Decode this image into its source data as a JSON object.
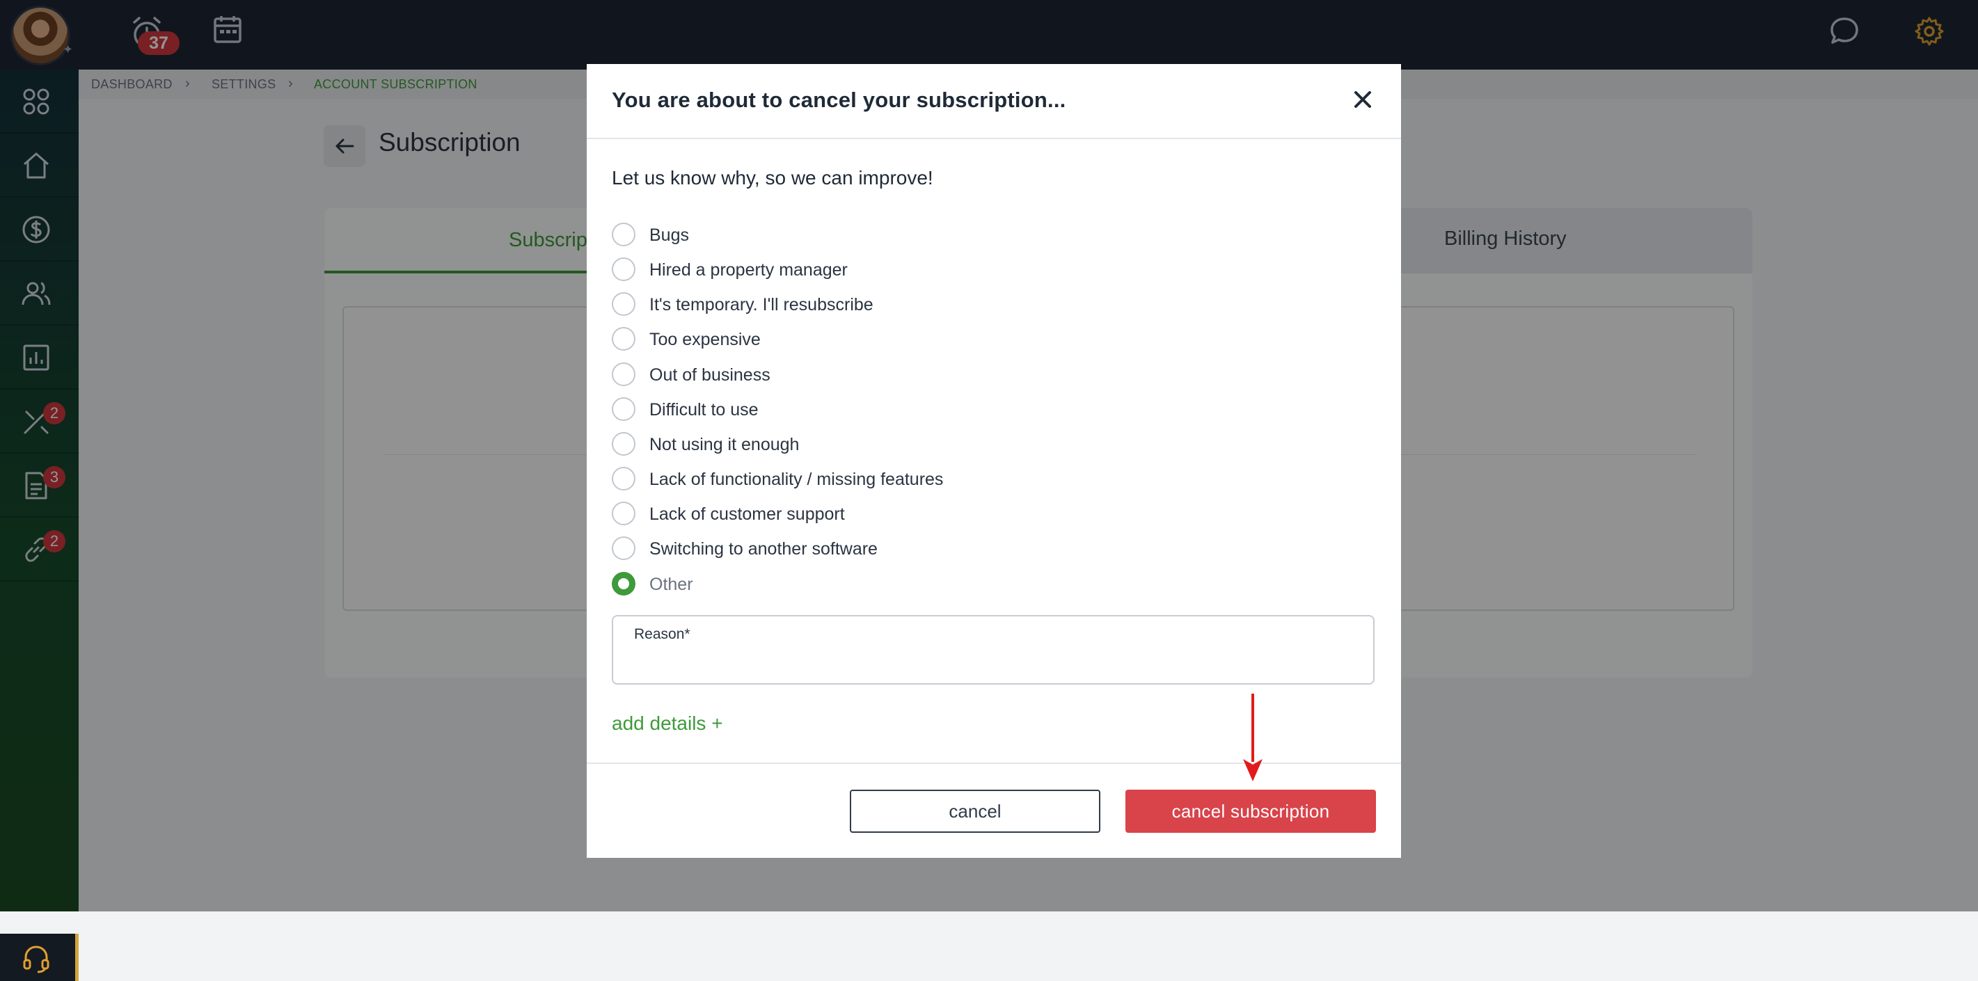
{
  "topbar": {
    "alarm_badge": "37",
    "icons": [
      "avatar",
      "pin-icon",
      "alarm-clock-icon",
      "calendar-icon",
      "chat-icon",
      "gear-icon"
    ],
    "accent_color": "#e0a030"
  },
  "sidebar": {
    "items": [
      {
        "icon": "apps-grid-icon",
        "badge": ""
      },
      {
        "icon": "home-icon",
        "badge": ""
      },
      {
        "icon": "dollar-icon",
        "badge": ""
      },
      {
        "icon": "users-icon",
        "badge": ""
      },
      {
        "icon": "reports-icon",
        "badge": ""
      },
      {
        "icon": "tools-icon",
        "badge": "2"
      },
      {
        "icon": "document-icon",
        "badge": "3"
      },
      {
        "icon": "link-icon",
        "badge": "2"
      }
    ],
    "support_icon": "headset-icon"
  },
  "breadcrumb": [
    "DASHBOARD",
    "SETTINGS",
    "ACCOUNT SUBSCRIPTION"
  ],
  "page": {
    "title": "Subscription",
    "tabs": [
      "Subscrip",
      "Billing History"
    ]
  },
  "modal": {
    "title": "You are about to cancel your subscription...",
    "subtitle": "Let us know why, so we can improve!",
    "options": [
      {
        "label": "Bugs",
        "checked": false
      },
      {
        "label": "Hired a property manager",
        "checked": false
      },
      {
        "label": "It's temporary. I'll resubscribe",
        "checked": false
      },
      {
        "label": "Too expensive",
        "checked": false
      },
      {
        "label": "Out of business",
        "checked": false
      },
      {
        "label": "Difficult to use",
        "checked": false
      },
      {
        "label": "Not using it enough",
        "checked": false
      },
      {
        "label": "Lack of functionality / missing features",
        "checked": false
      },
      {
        "label": "Lack of customer support",
        "checked": false
      },
      {
        "label": "Switching to another software",
        "checked": false
      },
      {
        "label": "Other",
        "checked": true
      }
    ],
    "reason_label": "Reason*",
    "reason_value": "",
    "add_details": "add details +",
    "cancel_label": "cancel",
    "confirm_label": "cancel subscription",
    "confirm_color": "#d9434a",
    "selected_color": "#3e9a3a"
  }
}
